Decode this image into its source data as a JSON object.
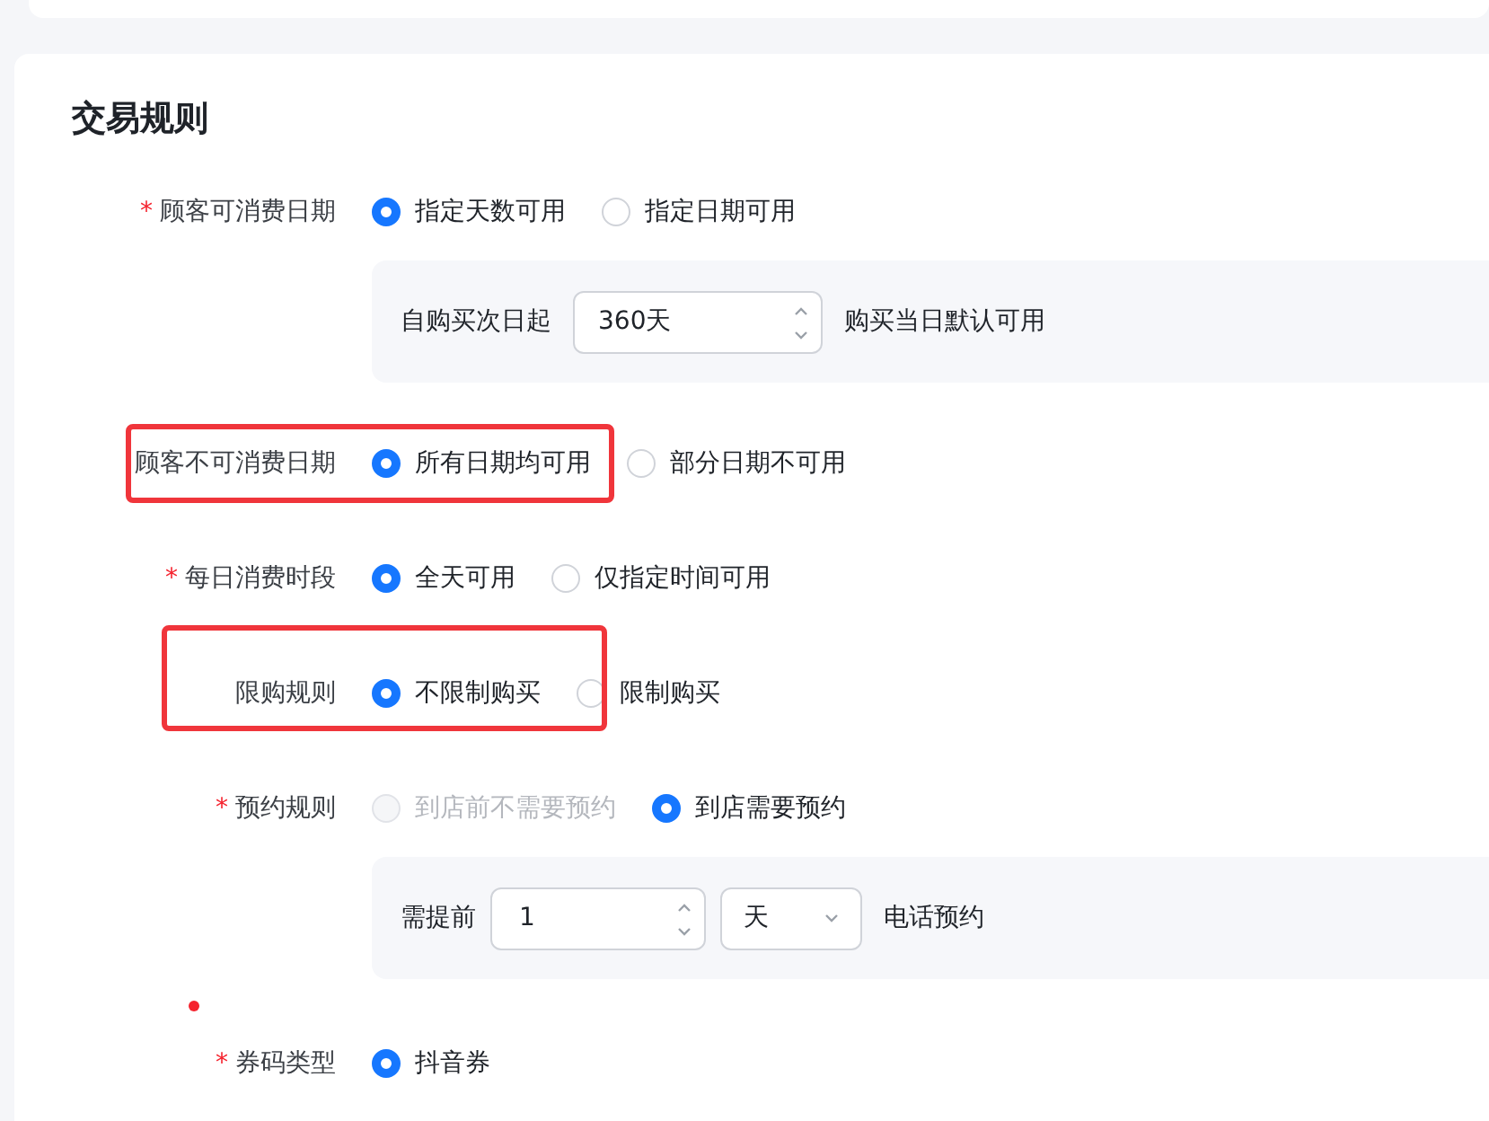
{
  "section_title": "交易规则",
  "rows": [
    {
      "label": "顾客可消费日期",
      "required_mark": "*",
      "highlighted": false,
      "options": [
        {
          "label": "指定天数可用",
          "selected": true,
          "disabled": false
        },
        {
          "label": "指定日期可用",
          "selected": false,
          "disabled": false
        }
      ],
      "panel": {
        "kind": "days",
        "prefix": "自购买次日起",
        "value": "360天",
        "suffix": "购买当日默认可用"
      }
    },
    {
      "label": "顾客不可消费日期",
      "highlighted": true,
      "options": [
        {
          "label": "所有日期均可用",
          "selected": true,
          "disabled": false
        },
        {
          "label": "部分日期不可用",
          "selected": false,
          "disabled": false
        }
      ]
    },
    {
      "label": "每日消费时段",
      "required_mark": "*",
      "highlighted": false,
      "options": [
        {
          "label": "全天可用",
          "selected": true,
          "disabled": false
        },
        {
          "label": "仅指定时间可用",
          "selected": false,
          "disabled": false
        }
      ]
    },
    {
      "label": "限购规则",
      "highlighted": true,
      "options": [
        {
          "label": "不限制购买",
          "selected": true,
          "disabled": false
        },
        {
          "label": "限制购买",
          "selected": false,
          "disabled": false
        }
      ]
    },
    {
      "label": "预约规则",
      "required_mark": "*",
      "highlighted": false,
      "options": [
        {
          "label": "到店前不需要预约",
          "selected": false,
          "disabled": true
        },
        {
          "label": "到店需要预约",
          "selected": true,
          "disabled": false
        }
      ],
      "panel": {
        "kind": "advance",
        "prefix": "需提前",
        "value": "1",
        "unit": "天",
        "suffix": "电话预约"
      }
    },
    {
      "label": "券码类型",
      "required_mark": "*",
      "highlighted": false,
      "dot_before": true,
      "options": [
        {
          "label": "抖音券",
          "selected": true,
          "disabled": false
        }
      ]
    }
  ]
}
